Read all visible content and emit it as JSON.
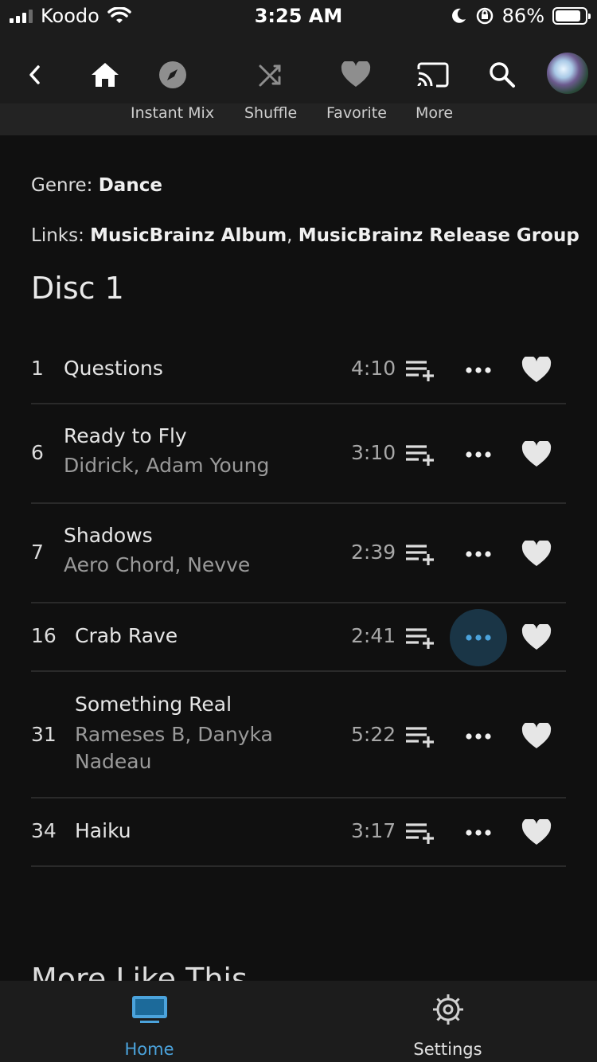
{
  "status_bar": {
    "carrier": "Koodo",
    "time": "3:25 AM",
    "battery": "86%",
    "battery_level": 0.86
  },
  "header": {
    "icons": [
      "back-chevron-icon",
      "home-icon",
      "compass-icon",
      "shuffle-icon",
      "heart-icon",
      "cast-icon",
      "search-icon",
      "avatar"
    ],
    "actions": {
      "instant_mix": "Instant Mix",
      "shuffle": "Shuffle",
      "favorite": "Favorite",
      "more": "More"
    }
  },
  "album_info": {
    "genre_label": "Genre:",
    "genre_value": "Dance",
    "links_label": "Links:",
    "link_1": "MusicBrainz Album",
    "link_sep": ",",
    "link_2": "MusicBrainz Release Group"
  },
  "disc": {
    "title": "Disc 1"
  },
  "tracks": [
    {
      "number": "1",
      "title": "Questions",
      "artist": "",
      "duration": "4:10"
    },
    {
      "number": "6",
      "title": "Ready to Fly",
      "artist": "Didrick, Adam Young",
      "duration": "3:10"
    },
    {
      "number": "7",
      "title": "Shadows",
      "artist": "Aero Chord, Nevve",
      "duration": "2:39"
    },
    {
      "number": "16",
      "title": "Crab Rave",
      "artist": "",
      "duration": "2:41"
    },
    {
      "number": "31",
      "title": "Something Real",
      "artist": "Rameses B, Danyka Nadeau",
      "duration": "5:22"
    },
    {
      "number": "34",
      "title": "Haiku",
      "artist": "",
      "duration": "3:17"
    }
  ],
  "more_like_this": "More Like This",
  "bottom_nav": {
    "home": "Home",
    "settings": "Settings"
  },
  "colors": {
    "accent": "#4ba3dc",
    "background": "#101010",
    "bar": "#1c1c1c"
  }
}
